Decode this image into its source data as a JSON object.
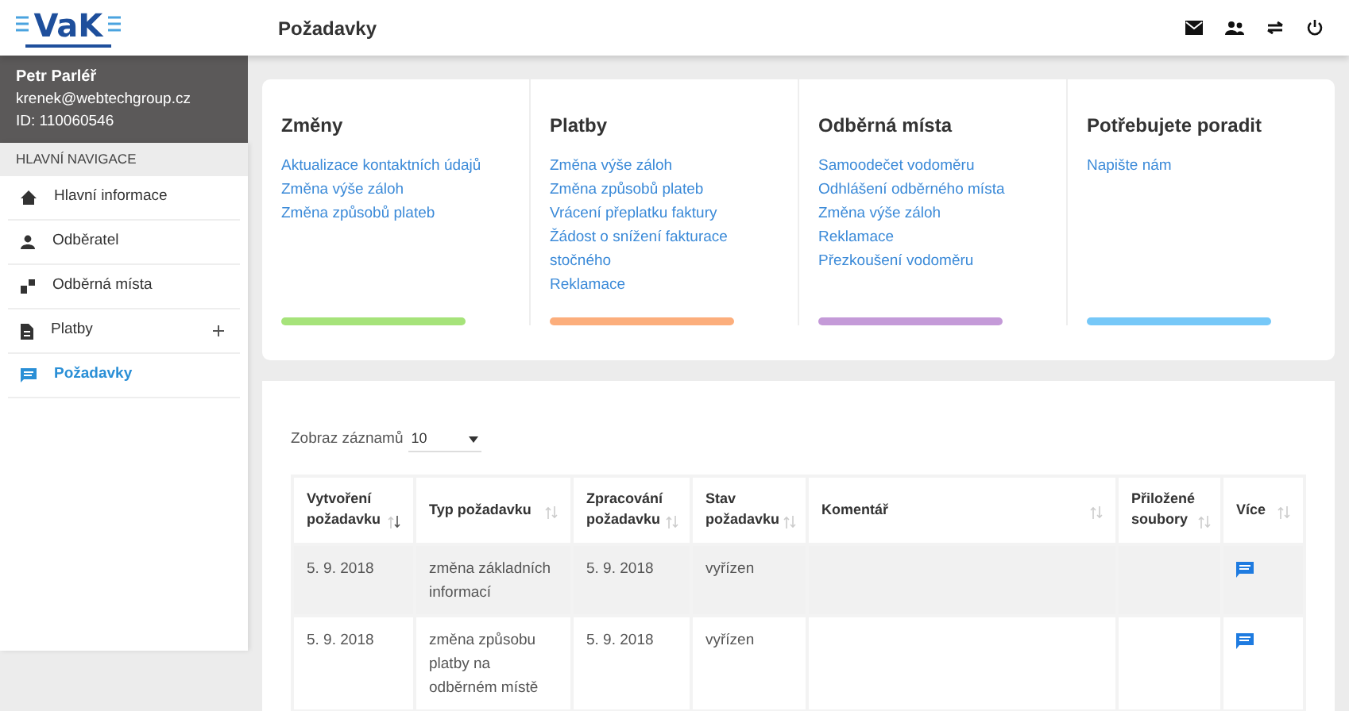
{
  "logo": {
    "text": "VaK"
  },
  "header": {
    "title": "Požadavky"
  },
  "user": {
    "name": "Petr Parléř",
    "email": "krenek@webtechgroup.cz",
    "id": "ID: 110060546"
  },
  "sidebar": {
    "heading": "HLAVNÍ NAVIGACE",
    "items": [
      {
        "label": "Hlavní informace",
        "selected": false,
        "expandable": false
      },
      {
        "label": "Odběratel",
        "selected": false,
        "expandable": false
      },
      {
        "label": "Odběrná místa",
        "selected": false,
        "expandable": false
      },
      {
        "label": "Platby",
        "selected": false,
        "expandable": true
      },
      {
        "label": "Požadavky",
        "selected": true,
        "expandable": false
      }
    ]
  },
  "quick_links": [
    {
      "title": "Změny",
      "color": "#a6e37a",
      "links": [
        "Aktualizace kontaktních údajů",
        "Změna výše záloh",
        "Změna způsobů plateb"
      ]
    },
    {
      "title": "Platby",
      "color": "#fcae7c",
      "links": [
        "Změna výše záloh",
        "Změna způsobů plateb",
        "Vrácení přeplatku faktury",
        "Žádost o snížení fakturace stočného",
        "Reklamace"
      ]
    },
    {
      "title": "Odběrná místa",
      "color": "#c49ad8",
      "links": [
        "Samoodečet vodoměru",
        "Odhlášení odběrného místa",
        "Změna výše záloh",
        "Reklamace",
        "Přezkoušení vodoměru"
      ]
    },
    {
      "title": "Potřebujete poradit",
      "color": "#76c8f8",
      "links": [
        "Napište nám"
      ]
    }
  ],
  "table": {
    "page_size_label": "Zobraz záznamů",
    "page_size": "10",
    "columns": [
      {
        "label": "Vytvoření požadavku",
        "sorted": true
      },
      {
        "label": "Typ požadavku",
        "sorted": false
      },
      {
        "label": "Zpracování požadavku",
        "sorted": false
      },
      {
        "label": "Stav požadavku",
        "sorted": false
      },
      {
        "label": "Komentář",
        "sorted": false
      },
      {
        "label": "Přiložené soubory",
        "sorted": false
      },
      {
        "label": "Více",
        "sorted": false
      }
    ],
    "rows": [
      {
        "cells": [
          "5. 9. 2018",
          "změna základních informací",
          "5. 9. 2018",
          "vyřízen",
          "",
          ""
        ]
      },
      {
        "cells": [
          "5. 9. 2018",
          "změna způsobu platby na odběrném místě",
          "5. 9. 2018",
          "vyřízen",
          "",
          ""
        ]
      }
    ]
  }
}
